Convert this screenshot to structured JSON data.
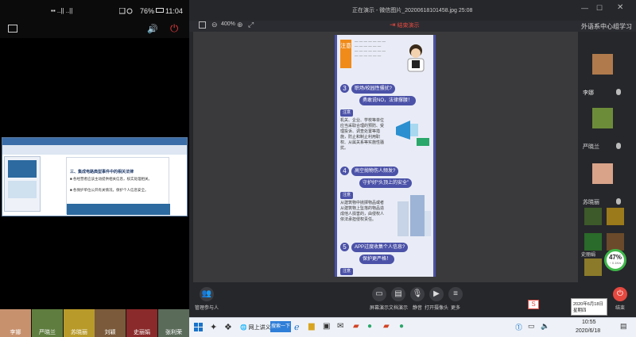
{
  "phone": {
    "status": {
      "left_indicators": "▪▪ ..|| ..||",
      "percent": "76%",
      "time": "11:04"
    },
    "screen": {
      "heading": "三、集成电路典型事件中的相关法律",
      "bullet1": "■ 各经营者应该主动提供相关信息，核实处理相关。",
      "bullet2": "■ 各保护单位公开有关情况，保护个人信息安全。"
    },
    "thumbnails": [
      {
        "label": "李娜",
        "color": "#c8916e"
      },
      {
        "label": "严晓兰",
        "color": "#5f7d3f"
      },
      {
        "label": "苏晓丽",
        "color": "#b89a2a"
      },
      {
        "label": "刘颖",
        "color": "#7a5a3a"
      },
      {
        "label": "史丽娟",
        "color": "#8a2a2a"
      },
      {
        "label": "张利荣",
        "color": "#5b6b5a"
      }
    ]
  },
  "window": {
    "title": "正在演示 - 微信图片_20200618101458.jpg 25:08",
    "zoom": "400%",
    "stop_share": "结束演示"
  },
  "infographic": {
    "banner": "注意",
    "sections": [
      {
        "num": "3",
        "head": "职场/校园性骚扰?",
        "head2": "勇敢说NO，法律撑腰！",
        "tag": "注意",
        "body": "机关、企业、学校等单位应当采取合理的预防、受理投诉、调查处置等措施，防止和制止利用职权、从属关系等实施性骚扰。"
      },
      {
        "num": "4",
        "head": "高空抛物伤人频发?",
        "head2": "守护好“头顶上的安全”",
        "tag": "注意",
        "body": "从建筑物中抛掷物品或者从建筑物上坠落的物品造成他人损害的，由侵权人依法承担侵权责任。"
      },
      {
        "num": "5",
        "head": "APP过度收集个人信息?",
        "head2": "保护更严格！",
        "tag": "注意",
        "body": ""
      }
    ]
  },
  "side_panel": {
    "title": "外语系中心组学习",
    "participants": [
      {
        "name": "李娜",
        "color": "#b07a4c"
      },
      {
        "name": "严晓兰",
        "color": "#6d8c3a"
      },
      {
        "name": "苏晓丽",
        "color": "#d9a38a"
      }
    ],
    "grid": [
      "#3d5a2a",
      "#9a7a1a",
      "#2a6a2a",
      "#6a4a2a",
      "#8a7a2a",
      "#4a6a3a"
    ],
    "grid_label": "史丽娟",
    "gauge": {
      "value": 47,
      "text": "47%",
      "sub": "↑ 0.1K/s"
    }
  },
  "controls": {
    "manage": "管理参与人",
    "share": "屏幕演示",
    "doc": "文档演示",
    "mute": "静音",
    "camera": "打开摄像头",
    "more": "更多",
    "end": "结束"
  },
  "taskbar": {
    "search": "网上讲义",
    "app": "搜索一下",
    "date_popup1": "2020年6月18日",
    "date_popup2": "星期四",
    "time": "10:55",
    "date": "2020/6/18"
  }
}
